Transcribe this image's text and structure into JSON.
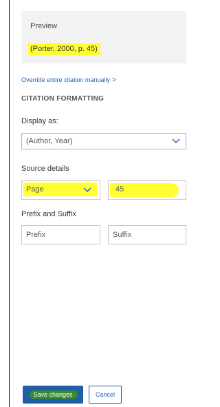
{
  "preview": {
    "label": "Preview",
    "citation": "(Porter, 2000, p. 45)"
  },
  "override_link": {
    "label": "Override entire citation manually",
    "chevron": ">"
  },
  "formatting": {
    "heading": "CITATION FORMATTING",
    "display_as_label": "Display as:",
    "display_as_value": "(Author, Year)"
  },
  "source_details": {
    "label": "Source details",
    "locator_type": "Page",
    "locator_value": "45"
  },
  "prefix_suffix": {
    "label": "Prefix and Suffix",
    "prefix_placeholder": "Prefix",
    "suffix_placeholder": "Suffix"
  },
  "actions": {
    "save_label": "Save changes",
    "cancel_label": "Cancel"
  },
  "colors": {
    "accent": "#1f5fa8",
    "highlight": "#ffff33",
    "preview_bg": "#f2f2f2"
  },
  "icons": {
    "link_chevron": "chevron-right-icon",
    "dropdown": "chevron-down-icon"
  }
}
